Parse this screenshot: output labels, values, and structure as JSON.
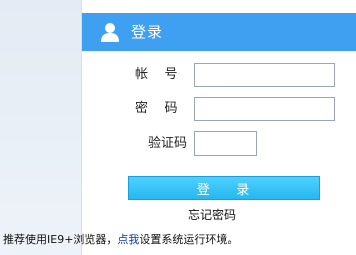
{
  "header": {
    "icon": "user-icon",
    "title": "登录"
  },
  "form": {
    "account_label": "帐    号",
    "account_value": "",
    "password_label": "密    码",
    "password_value": "",
    "captcha_label": "验证码",
    "captcha_value": ""
  },
  "login_button_label": "登    录",
  "forgot_password_label": "忘记密码",
  "browser_hint": {
    "prefix": "推荐使用IE9+浏览器，",
    "link": "点我",
    "suffix": "设置系统运行环境。"
  },
  "colors": {
    "header_bg": "#3f9ff0",
    "button_bg": "#25b8f0",
    "link": "#0a3c9a"
  }
}
